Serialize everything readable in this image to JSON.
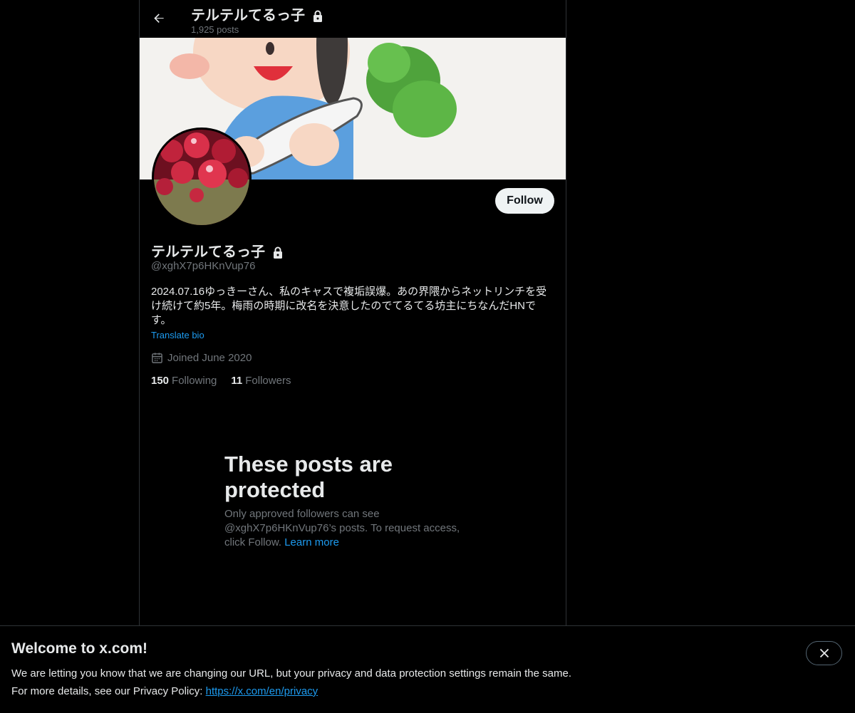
{
  "header": {
    "title": "テルテルてるっ子",
    "post_count": "1,925 posts"
  },
  "profile": {
    "display_name": "テルテルてるっ子",
    "handle": "@xghX7p6HKnVup76",
    "bio": "2024.07.16ゆっきーさん、私のキャスで複垢誤爆。あの界隈からネットリンチを受け続けて約5年。梅雨の時期に改名を決意したのでてるてる坊主にちなんだHNです。",
    "translate_label": "Translate bio",
    "joined": "Joined June 2020",
    "following_count": "150",
    "following_label": "Following",
    "followers_count": "11",
    "followers_label": "Followers",
    "follow_button": "Follow"
  },
  "protected_notice": {
    "title": "These posts are protected",
    "body": "Only approved followers can see @xghX7p6HKnVup76’s posts. To request access, click Follow.",
    "link": "Learn more"
  },
  "cookie_banner": {
    "title": "Welcome to x.com!",
    "line1": "We are letting you know that we are changing our URL, but your privacy and data protection settings remain the same.",
    "line2_prefix": "For more details, see our Privacy Policy:",
    "privacy_link": "https://x.com/en/privacy"
  },
  "icons": [
    "back-arrow-icon",
    "lock-icon",
    "calendar-icon",
    "close-icon"
  ],
  "colors": {
    "accent": "#1d9bf0",
    "muted": "#71767b",
    "text": "#e7e9ea",
    "background": "#000000"
  }
}
